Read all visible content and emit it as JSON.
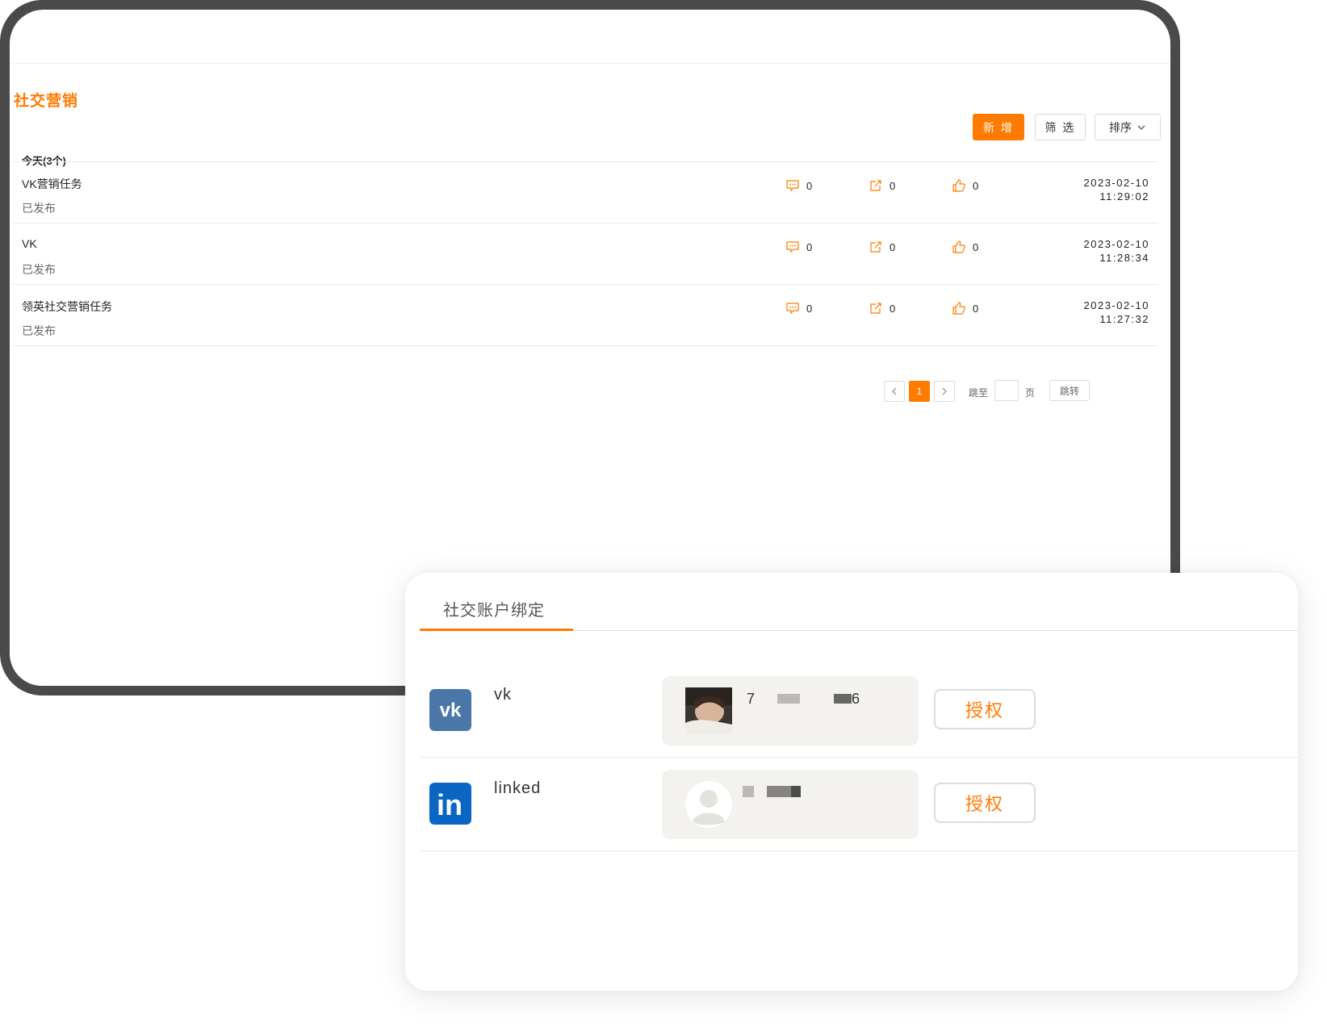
{
  "window": {
    "page_title": "社交营销",
    "toolbar": {
      "add_label": "新 增",
      "filter_label": "筛 选",
      "sort_label": "排序"
    },
    "group_label": "今天(3个)",
    "tasks": [
      {
        "name": "VK营销任务",
        "status": "已发布",
        "comments": "0",
        "shares": "0",
        "likes": "0",
        "date": "2023-02-10",
        "time": "11:29:02"
      },
      {
        "name": "VK",
        "status": "已发布",
        "comments": "0",
        "shares": "0",
        "likes": "0",
        "date": "2023-02-10",
        "time": "11:28:34"
      },
      {
        "name": "领英社交营销任务",
        "status": "已发布",
        "comments": "0",
        "shares": "0",
        "likes": "0",
        "date": "2023-02-10",
        "time": "11:27:32"
      }
    ],
    "pagination": {
      "current_page": "1",
      "goto_label": "跳至",
      "page_label": "页",
      "jump_label": "跳转"
    }
  },
  "binding_card": {
    "tab_label": "社交账户绑定",
    "accounts": [
      {
        "platform": "vk",
        "logo_icon": "vk-logo-icon",
        "handle_prefix": "7",
        "handle_suffix": "6",
        "auth_label": "授权"
      },
      {
        "platform": "linked",
        "logo_icon": "linkedin-logo-icon",
        "auth_label": "授权"
      }
    ]
  },
  "colors": {
    "accent": "#ff7a00",
    "frame": "#4a4a4a",
    "vk_blue": "#4a76a8",
    "linkedin_blue": "#0a66c2",
    "panel_bg": "#f3f2ee"
  }
}
